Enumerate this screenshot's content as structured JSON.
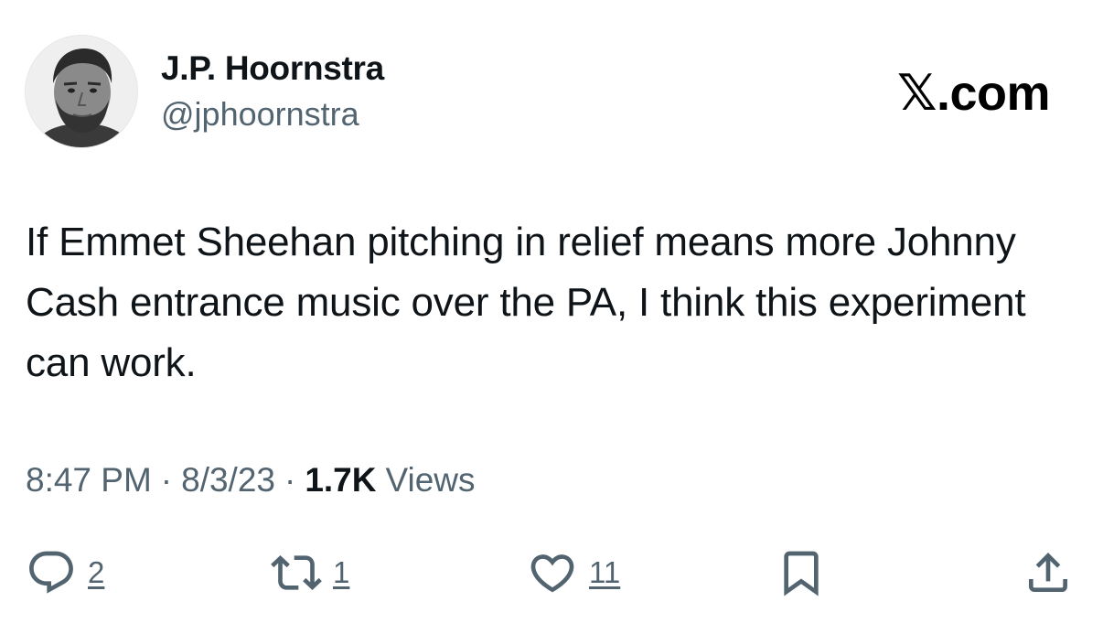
{
  "author": {
    "display_name": "J.P. Hoornstra",
    "handle": "@jphoornstra",
    "avatar_icon": "profile-photo"
  },
  "brand": "𝕏.com",
  "tweet": {
    "text": "If Emmet Sheehan pitching in relief means more Johnny Cash entrance music over the PA, I think this experiment can work."
  },
  "meta": {
    "time": "8:47 PM",
    "date": "8/3/23",
    "separator": "·",
    "views_count": "1.7K",
    "views_label": "Views"
  },
  "actions": {
    "reply": {
      "icon": "reply-icon",
      "count": "2"
    },
    "retweet": {
      "icon": "retweet-icon",
      "count": "1"
    },
    "like": {
      "icon": "heart-icon",
      "count": "11"
    },
    "bookmark": {
      "icon": "bookmark-icon"
    },
    "share": {
      "icon": "share-icon"
    }
  },
  "colors": {
    "text_primary": "#0f1419",
    "text_secondary": "#536471",
    "background": "#ffffff"
  }
}
